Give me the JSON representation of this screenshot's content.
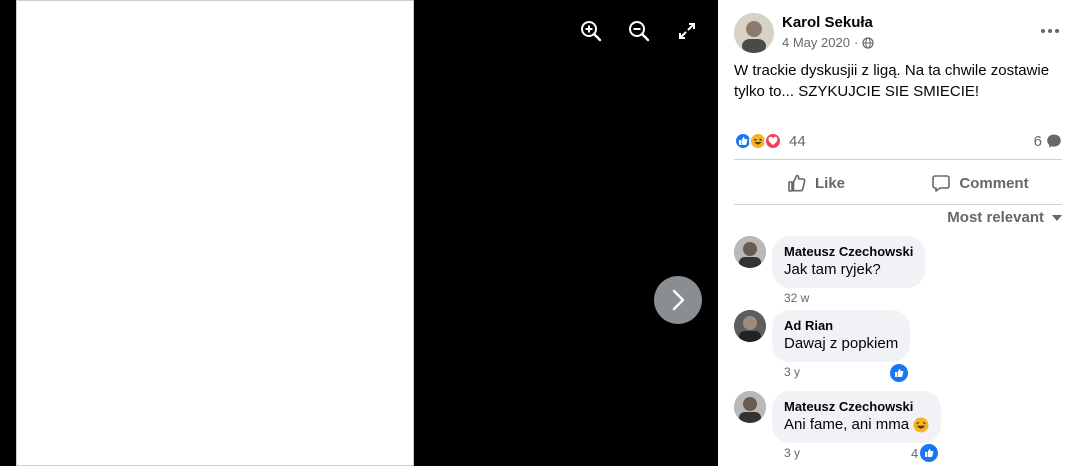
{
  "viewer": {
    "photo": "fighter-photo"
  },
  "post": {
    "author": "Karol Sekuła",
    "date": "4 May 2020",
    "privacy_icon": "globe-icon",
    "text": "W trackie dyskusjii z ligą. Na ta chwile zostawie tylko to... SZYKUJCIE SIE SMIECIE!",
    "reaction_count": "44",
    "comment_count": "6"
  },
  "actions": {
    "like": "Like",
    "comment": "Comment"
  },
  "sort": {
    "label": "Most relevant"
  },
  "comments": [
    {
      "author": "Mateusz Czechowski",
      "text": "Jak tam ryjek?",
      "time": "32 w"
    },
    {
      "author": "Ad Rian",
      "text": "Dawaj z popkiem",
      "time": "3 y"
    },
    {
      "author": "Mateusz Czechowski",
      "text": "Ani fame, ani mma",
      "time": "3 y",
      "likes": "4"
    }
  ],
  "colors": {
    "like_blue": "#1877f2",
    "love_red": "#f33e58",
    "haha_yellow": "#f7b125"
  }
}
